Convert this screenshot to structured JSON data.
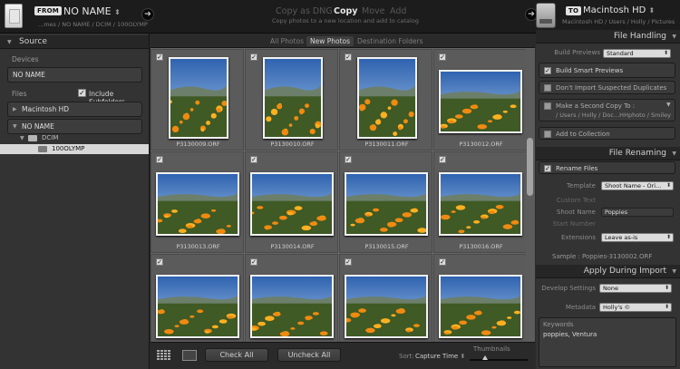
{
  "top": {
    "from_badge": "FROM",
    "source_name": "NO NAME",
    "source_path": "...mes / NO NAME / DCIM / 100OLYMP",
    "modes": [
      "Copy as DNG",
      "Copy",
      "Move",
      "Add"
    ],
    "active_mode": "Copy",
    "mode_description": "Copy photos to a new location and add to catalog",
    "to_badge": "TO",
    "destination_name": "Macintosh HD",
    "destination_path": "Macintosh HD / Users / Holly / Pictures"
  },
  "source": {
    "title": "Source",
    "devices_label": "Devices",
    "device": "NO NAME",
    "files_label": "Files",
    "include_subfolders": "Include Subfolders",
    "volumes": [
      "Macintosh HD",
      "NO NAME"
    ],
    "folders": [
      "DCIM",
      "100OLYMP"
    ]
  },
  "grid": {
    "tabs": [
      "All Photos",
      "New Photos",
      "Destination Folders"
    ],
    "active_tab": "New Photos",
    "photos": [
      {
        "name": "P3130009.ORF"
      },
      {
        "name": "P3130010.ORF"
      },
      {
        "name": "P3130011.ORF"
      },
      {
        "name": "P3130012.ORF"
      },
      {
        "name": "P3130013.ORF"
      },
      {
        "name": "P3130014.ORF"
      },
      {
        "name": "P3130015.ORF"
      },
      {
        "name": "P3130016.ORF"
      },
      {
        "name": ""
      },
      {
        "name": ""
      },
      {
        "name": ""
      },
      {
        "name": ""
      }
    ],
    "check_all": "Check All",
    "uncheck_all": "Uncheck All",
    "sort_label": "Sort:",
    "sort_value": "Capture Time",
    "thumbnails_label": "Thumbnails"
  },
  "file_handling": {
    "title": "File Handling",
    "build_previews_label": "Build Previews",
    "build_previews_value": "Standard",
    "build_smart_previews": "Build Smart Previews",
    "dont_import_duplicates": "Don't Import Suspected Duplicates",
    "second_copy": "Make a Second Copy To :",
    "second_copy_path": "/ Users / Holly / Doc...HHphoto / Smiley",
    "add_to_collection": "Add to Collection"
  },
  "file_renaming": {
    "title": "File Renaming",
    "rename_files": "Rename Files",
    "template_label": "Template",
    "template_value": "Shoot Name - Ori...",
    "custom_text_label": "Custom Text",
    "shoot_name_label": "Shoot Name",
    "shoot_name_value": "Poppies",
    "start_number_label": "Start Number",
    "extensions_label": "Extensions",
    "extensions_value": "Leave as-is",
    "sample": "Sample :  Poppies-3130002.ORF"
  },
  "apply_during_import": {
    "title": "Apply During Import",
    "develop_settings_label": "Develop Settings",
    "develop_settings_value": "None",
    "metadata_label": "Metadata",
    "metadata_value": "Holly's ©",
    "keywords_label": "Keywords",
    "keywords_value": "poppies, Ventura"
  }
}
